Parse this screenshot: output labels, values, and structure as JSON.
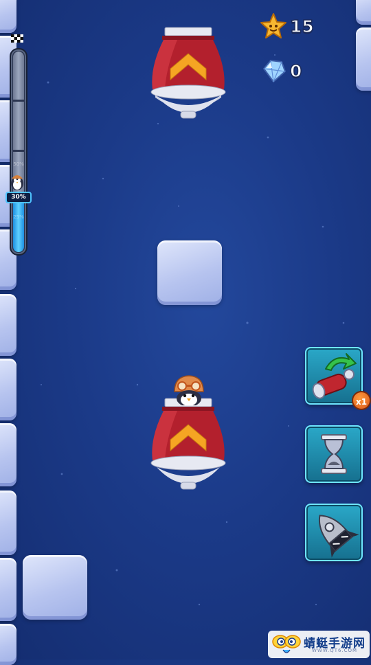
{
  "hud": {
    "stars_count": "15",
    "gems_count": "0"
  },
  "progress": {
    "percent_label": "30%",
    "fraction": 0.3,
    "tick_upper": "50%",
    "tick_lower": "25%"
  },
  "powerups": {
    "magnet_cannon_count": "x1",
    "items": [
      "magnet-cannon",
      "hourglass",
      "rocket"
    ]
  },
  "watermark": {
    "text": "蜻蜓手游网",
    "sub": "WWW.QT6.COM"
  },
  "colors": {
    "background": "#1b3a88",
    "cannon_red": "#b3202d",
    "chevron_orange": "#f5a523",
    "button_teal": "#1f8fb0",
    "progress_fill": "#3fb8f5"
  }
}
